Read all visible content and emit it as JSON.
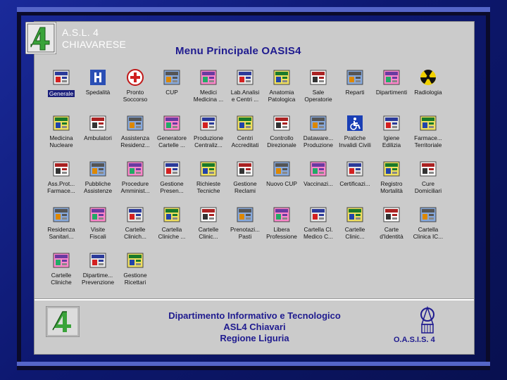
{
  "slide": {
    "title_line1": "A.S.L. 4",
    "title_line2": "CHIAVARESE"
  },
  "app": {
    "menu_title": "Menu Principale OASIS4",
    "selected_item": "Generale",
    "items": [
      {
        "label": "Generale",
        "icon": "general-icon"
      },
      {
        "label": "Spedalità",
        "icon": "hospital-icon"
      },
      {
        "label": "Pronto\nSoccorso",
        "icon": "first-aid-icon"
      },
      {
        "label": "CUP",
        "icon": "cup-icon"
      },
      {
        "label": "Medici\nMedicina ...",
        "icon": "doctor-icon"
      },
      {
        "label": "Lab.Analisi\ne Centri ...",
        "icon": "lab-icon"
      },
      {
        "label": "Anatomia\nPatologica",
        "icon": "microscope-icon"
      },
      {
        "label": "Sale\nOperatorie",
        "icon": "surgeon-icon"
      },
      {
        "label": "Reparti",
        "icon": "ward-icon"
      },
      {
        "label": "Dipartimenti",
        "icon": "departments-icon"
      },
      {
        "label": "Radiologia",
        "icon": "radiation-icon"
      },
      {
        "label": "Medicina\nNucleare",
        "icon": "nuclear-medicine-icon"
      },
      {
        "label": "Ambulatori",
        "icon": "clinic-icon"
      },
      {
        "label": "Assistenza\nResidenz...",
        "icon": "residential-care-icon"
      },
      {
        "label": "Generatore\nCartelle ...",
        "icon": "record-generator-icon"
      },
      {
        "label": "Produzione\nCentraliz...",
        "icon": "centralized-production-icon"
      },
      {
        "label": "Centri\nAccreditati",
        "icon": "accredited-centers-icon"
      },
      {
        "label": "Controllo\nDirezionale",
        "icon": "management-control-icon"
      },
      {
        "label": "Dataware...\nProduzione",
        "icon": "datawarehouse-icon"
      },
      {
        "label": "Pratiche\nInvalidi Civili",
        "icon": "disability-icon"
      },
      {
        "label": "Igiene\nEdilizia",
        "icon": "building-hygiene-icon"
      },
      {
        "label": "Farmace...\nTerritoriale",
        "icon": "pharmacy-icon"
      },
      {
        "label": "Ass.Prot...\nFarmace...",
        "icon": "prosthetics-icon"
      },
      {
        "label": "Pubbliche\nAssistenze",
        "icon": "ambulance-icon"
      },
      {
        "label": "Procedure\nAmminist...",
        "icon": "admin-procedures-icon"
      },
      {
        "label": "Gestione\nPresen...",
        "icon": "attendance-icon"
      },
      {
        "label": "Richieste\nTecniche",
        "icon": "tech-requests-icon"
      },
      {
        "label": "Gestione\nReclami",
        "icon": "complaints-icon"
      },
      {
        "label": "Nuovo CUP",
        "icon": "new-cup-icon"
      },
      {
        "label": "Vaccinazi...",
        "icon": "vaccination-icon"
      },
      {
        "label": "Certificazi...",
        "icon": "certificates-icon"
      },
      {
        "label": "Registro\nMortalità",
        "icon": "mortality-register-icon"
      },
      {
        "label": "Cure\nDomiciliari",
        "icon": "home-care-icon"
      },
      {
        "label": "Residenza\nSanitari...",
        "icon": "health-residence-icon"
      },
      {
        "label": "Visite\nFiscali",
        "icon": "fiscal-visits-icon"
      },
      {
        "label": "Cartelle\nClinich...",
        "icon": "clinical-folders-icon"
      },
      {
        "label": "Cartella\nCliniche ...",
        "icon": "clinical-records-icon"
      },
      {
        "label": "Cartelle\nClinic...",
        "icon": "clinical-docs-icon"
      },
      {
        "label": "Prenotazi...\nPasti",
        "icon": "meal-booking-icon"
      },
      {
        "label": "Libera\nProfessione",
        "icon": "private-practice-icon"
      },
      {
        "label": "Cartella Cl.\nMedico C...",
        "icon": "gp-record-icon"
      },
      {
        "label": "Cartelle\nClinic...",
        "icon": "clinical-archive-icon"
      },
      {
        "label": "Carte\nd'Identità",
        "icon": "id-card-icon"
      },
      {
        "label": "Cartella\nClinica IC...",
        "icon": "clinical-record-ic-icon"
      },
      {
        "label": "Cartelle\nCliniche",
        "icon": "clinical-binder-icon"
      },
      {
        "label": "Dipartime...\nPrevenzione",
        "icon": "prevention-icon"
      },
      {
        "label": "Gestione\nRicettari",
        "icon": "prescriptions-icon"
      }
    ]
  },
  "footer": {
    "line1": "Dipartimento Informativo e Tecnologico",
    "line2": "ASL4 Chiavari",
    "line3": "Regione Liguria",
    "oasis": "O.A.S.I.S. 4"
  },
  "colors": {
    "slide_bg": "#0d1870",
    "window_bg": "#cbcbcb",
    "title_blue": "#1f1b8f",
    "logo_green": "#3aa33a"
  }
}
